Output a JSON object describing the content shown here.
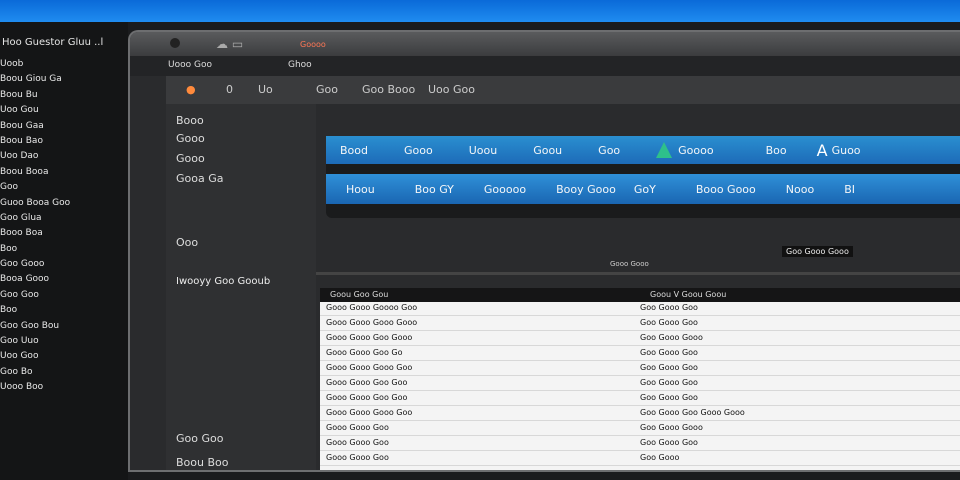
{
  "top_bar": {
    "color": "#1a7fe6"
  },
  "left_rail": {
    "title": "Hoo Guestor Gluu ..l",
    "items": [
      "Uoob",
      "Boou Giou Ga",
      "Boou Bu",
      "Uoo Gou",
      "Boou Gaa",
      "Boou Bao",
      "Uoo Dao",
      "Boou Booa",
      "Goo",
      "Guoo Booa Goo",
      "Goo Glua",
      "Booo Boa",
      "Boo",
      "Goo Gooo",
      "Booa Gooo",
      "Goo Goo",
      "Boo",
      "Goo Goo Bou",
      "Goo Uuo",
      "Uoo Goo",
      "Goo Bo",
      "Uooo Boo"
    ]
  },
  "window": {
    "title_badge": "Goooo",
    "path": [
      "Uooo Goo",
      "Ghoo"
    ],
    "toolbar": [
      "0",
      "Uo",
      "Goo",
      "Goo Booo",
      "Uoo Goo"
    ]
  },
  "sidebar": [
    "Booo",
    "Gooo",
    "Gooo",
    "Gooa Ga",
    "Ooo",
    "Iwooyy Goo Gooub",
    "Goo Goo",
    "Boou Boo"
  ],
  "ribbon": {
    "row1": [
      "Bood",
      "Gooo",
      "Uoou",
      "Goou",
      "Goo",
      "Goooo",
      "Boo",
      "Guoo"
    ],
    "row2": [
      "Hoou",
      "Boo GY",
      "Gooooo",
      "Booy Gooo",
      "GoY",
      "Booo Gooo",
      "Nooo",
      "BI"
    ]
  },
  "flags": [
    "Goo Gooo Gooo",
    "Gooo Gooo"
  ],
  "list_panel": {
    "header_left": "Goou Goo Gou",
    "header_right": "Goou V Goou Goou",
    "rows": [
      {
        "left": "Gooo Gooo Goooo Goo",
        "right": "Goo Gooo Goo"
      },
      {
        "left": "Gooo Gooo Gooo Gooo",
        "right": "Goo Gooo Goo"
      },
      {
        "left": "Gooo Gooo Goo Gooo",
        "right": "Goo Gooo Gooo"
      },
      {
        "left": "Gooo Gooo Goo Go",
        "right": "Goo Gooo Goo"
      },
      {
        "left": "Gooo Gooo Gooo Goo",
        "right": "Goo Gooo Goo"
      },
      {
        "left": "Gooo Gooo Goo Goo",
        "right": "Goo Gooo Goo"
      },
      {
        "left": "Gooo Gooo Goo Goo",
        "right": "Goo Gooo Goo"
      },
      {
        "left": "Gooo Gooo Gooo Goo",
        "right": "Goo Gooo Goo Gooo Gooo"
      },
      {
        "left": "Gooo Gooo Goo",
        "right": "Goo Gooo Gooo"
      },
      {
        "left": "Gooo Gooo Goo",
        "right": "Goo Gooo Goo"
      },
      {
        "left": "Gooo Gooo Goo",
        "right": "Goo Gooo"
      }
    ]
  }
}
